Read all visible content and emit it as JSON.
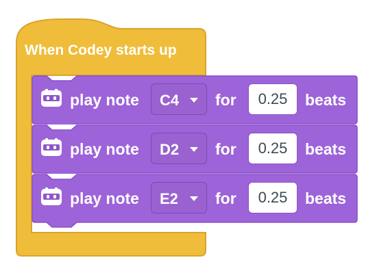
{
  "colors": {
    "hat_block": "#F0BD3A",
    "hat_block_border": "#D9A42C",
    "play_block": "#9D63D8",
    "play_block_border": "#8A4FC8",
    "dropdown_bg": "#9A62D0",
    "input_bg": "#FFFFFF",
    "text_light": "#FFFFFF",
    "text_input": "#3B4A52"
  },
  "hat": {
    "label": "When Codey starts up"
  },
  "blocks": [
    {
      "icon": "codey-robot-icon",
      "play_label": "play note",
      "note": "C4",
      "for_label": "for",
      "beats": "0.25",
      "beats_label": "beats"
    },
    {
      "icon": "codey-robot-icon",
      "play_label": "play note",
      "note": "D2",
      "for_label": "for",
      "beats": "0.25",
      "beats_label": "beats"
    },
    {
      "icon": "codey-robot-icon",
      "play_label": "play note",
      "note": "E2",
      "for_label": "for",
      "beats": "0.25",
      "beats_label": "beats"
    }
  ]
}
